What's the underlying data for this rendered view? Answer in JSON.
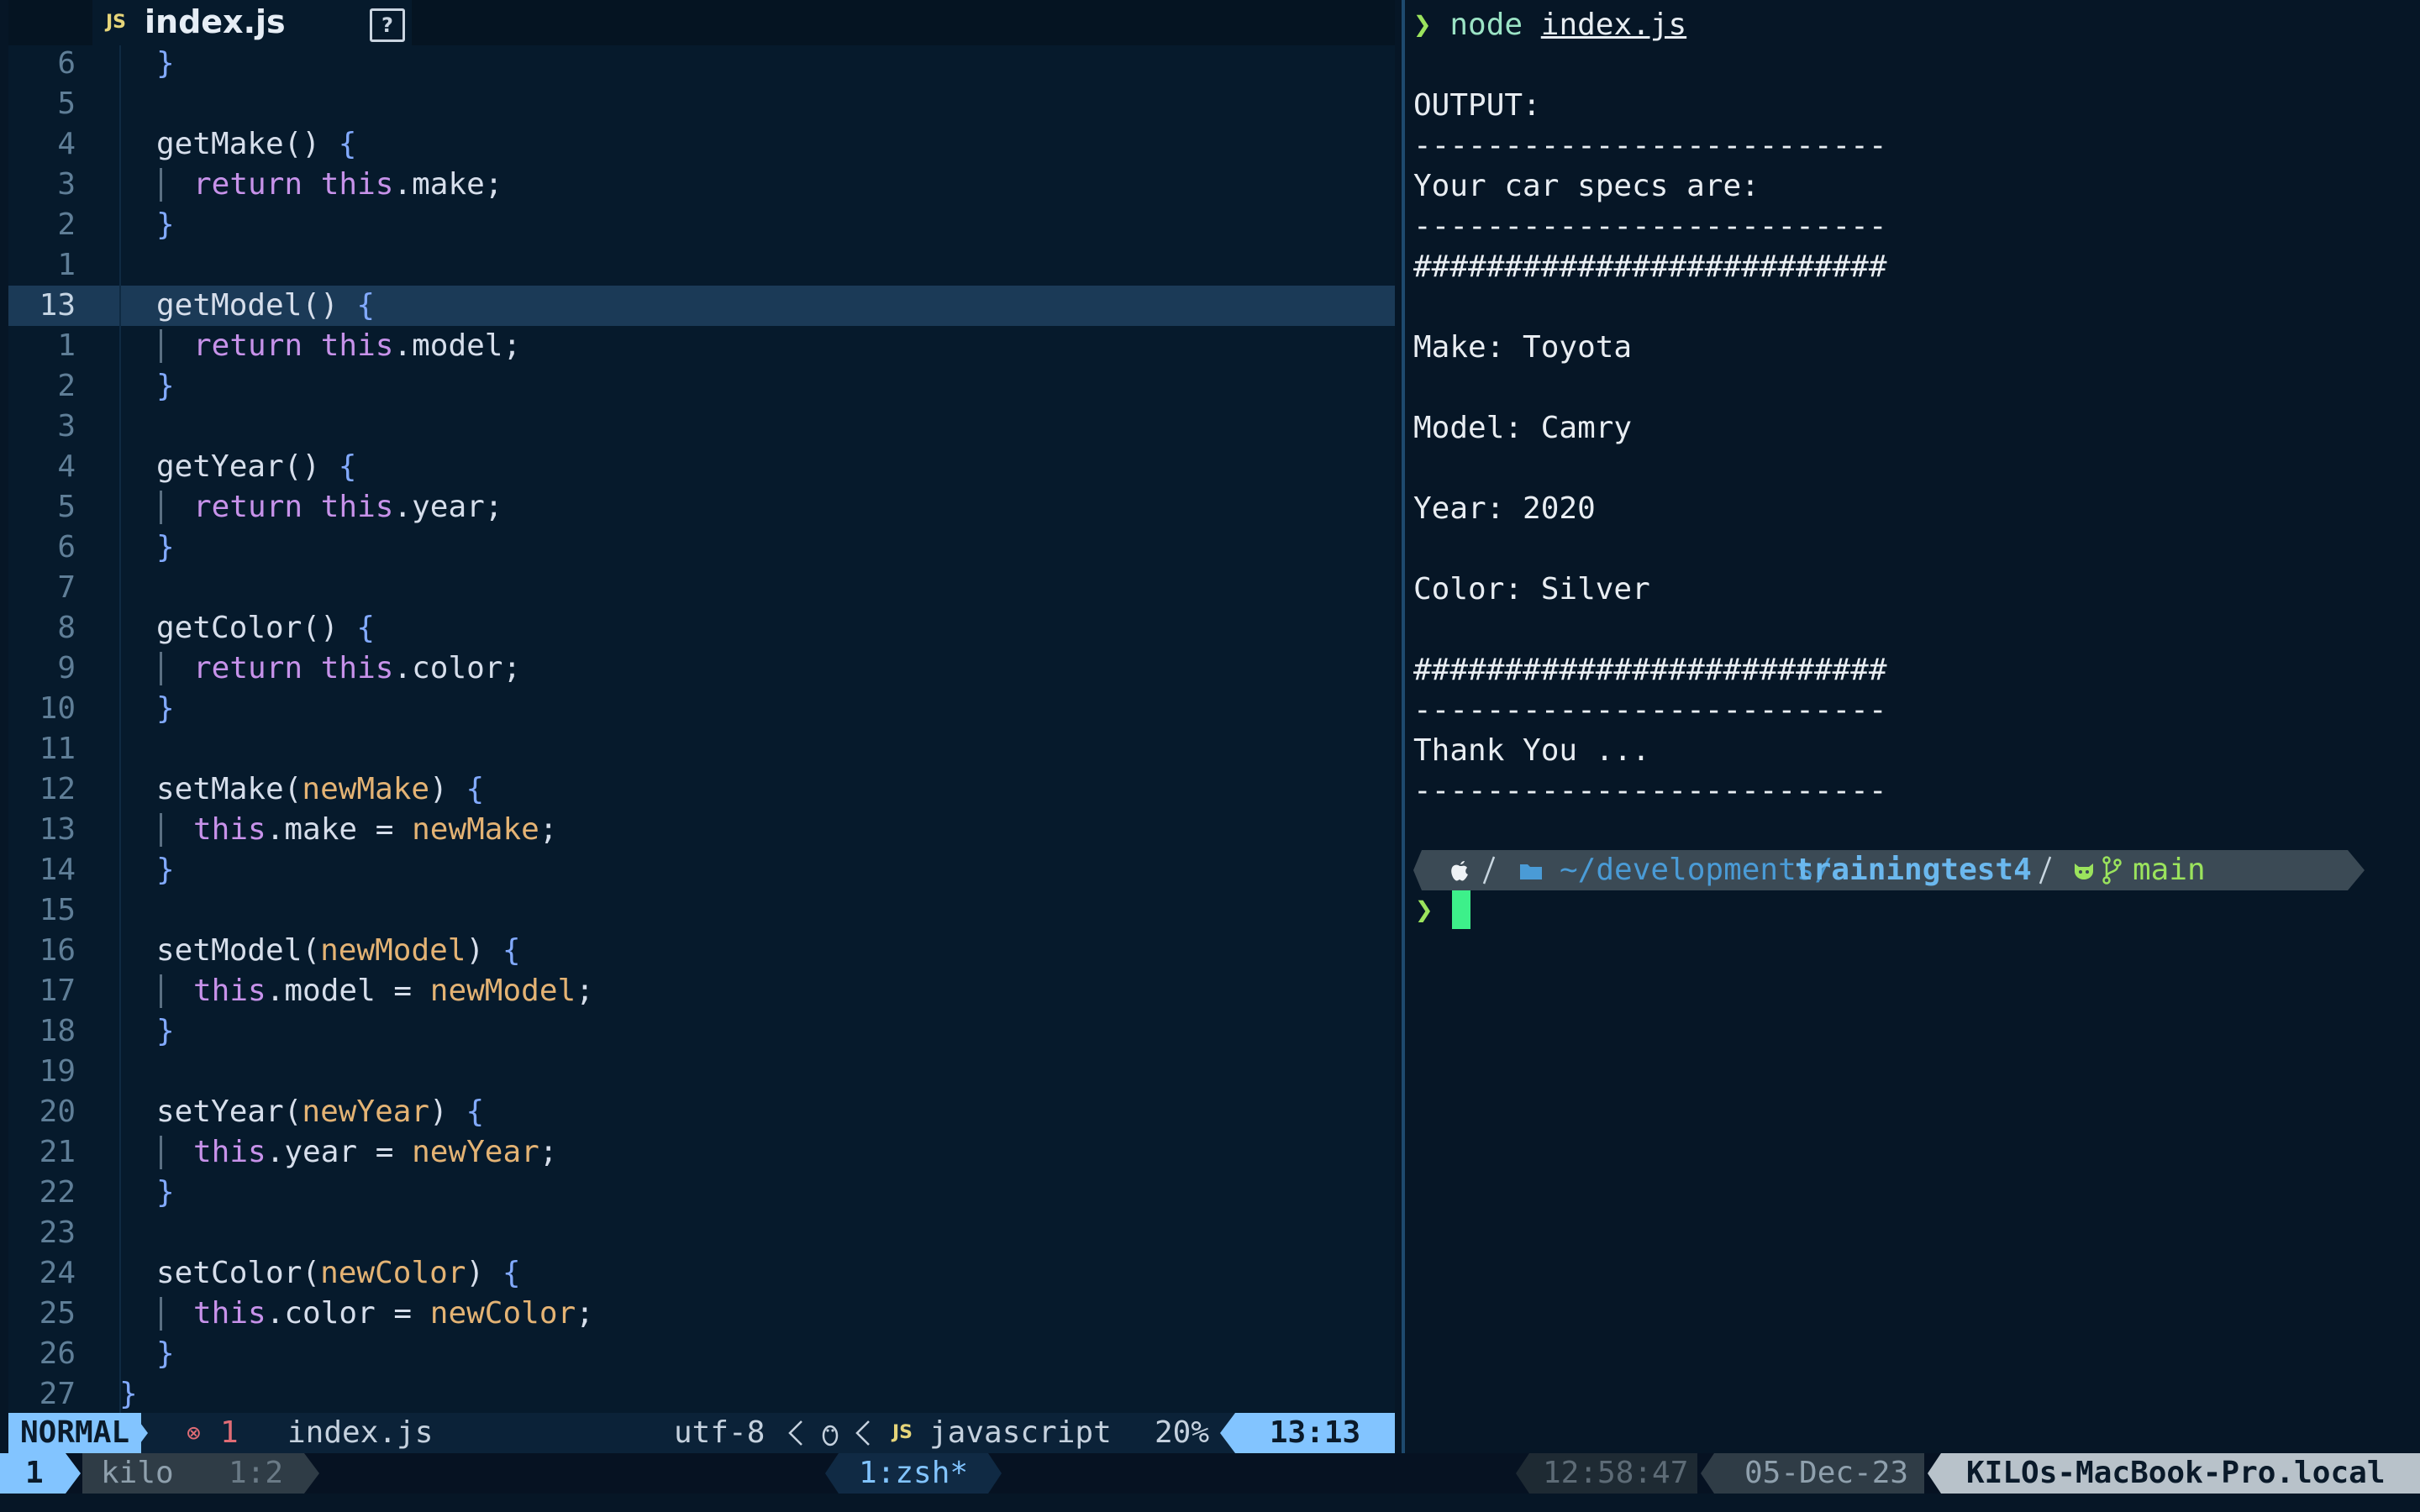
{
  "editor": {
    "tab": {
      "type_badge": "JS",
      "filename": "index.js",
      "help_glyph": "?"
    },
    "lines": [
      {
        "ln": "6",
        "indent": 1,
        "segs": [
          [
            "br",
            "}"
          ]
        ]
      },
      {
        "ln": "5",
        "indent": 0,
        "segs": []
      },
      {
        "ln": "4",
        "indent": 1,
        "segs": [
          [
            "fn",
            "getMake() "
          ],
          [
            "br",
            "{"
          ]
        ]
      },
      {
        "ln": "3",
        "indent": 2,
        "segs": [
          [
            "kw",
            "return "
          ],
          [
            "kw",
            "this"
          ],
          [
            "fn",
            ".make;"
          ]
        ]
      },
      {
        "ln": "2",
        "indent": 1,
        "segs": [
          [
            "br",
            "}"
          ]
        ]
      },
      {
        "ln": "1",
        "indent": 0,
        "segs": []
      },
      {
        "ln": "13",
        "indent": 1,
        "current": true,
        "segs": [
          [
            "fn",
            "getModel() "
          ],
          [
            "br",
            "{"
          ]
        ]
      },
      {
        "ln": "1",
        "indent": 2,
        "segs": [
          [
            "kw",
            "return "
          ],
          [
            "kw",
            "this"
          ],
          [
            "fn",
            ".model;"
          ]
        ]
      },
      {
        "ln": "2",
        "indent": 1,
        "segs": [
          [
            "br",
            "}"
          ]
        ]
      },
      {
        "ln": "3",
        "indent": 0,
        "segs": []
      },
      {
        "ln": "4",
        "indent": 1,
        "segs": [
          [
            "fn",
            "getYear() "
          ],
          [
            "br",
            "{"
          ]
        ]
      },
      {
        "ln": "5",
        "indent": 2,
        "segs": [
          [
            "kw",
            "return "
          ],
          [
            "kw",
            "this"
          ],
          [
            "fn",
            ".year;"
          ]
        ]
      },
      {
        "ln": "6",
        "indent": 1,
        "segs": [
          [
            "br",
            "}"
          ]
        ]
      },
      {
        "ln": "7",
        "indent": 0,
        "segs": []
      },
      {
        "ln": "8",
        "indent": 1,
        "segs": [
          [
            "fn",
            "getColor() "
          ],
          [
            "br",
            "{"
          ]
        ]
      },
      {
        "ln": "9",
        "indent": 2,
        "segs": [
          [
            "kw",
            "return "
          ],
          [
            "kw",
            "this"
          ],
          [
            "fn",
            ".color;"
          ]
        ]
      },
      {
        "ln": "10",
        "indent": 1,
        "segs": [
          [
            "br",
            "}"
          ]
        ]
      },
      {
        "ln": "11",
        "indent": 0,
        "segs": []
      },
      {
        "ln": "12",
        "indent": 1,
        "segs": [
          [
            "fn",
            "setMake("
          ],
          [
            "pm",
            "newMake"
          ],
          [
            "fn",
            ") "
          ],
          [
            "br",
            "{"
          ]
        ]
      },
      {
        "ln": "13",
        "indent": 2,
        "segs": [
          [
            "kw",
            "this"
          ],
          [
            "fn",
            ".make = "
          ],
          [
            "pm",
            "newMake"
          ],
          [
            "fn",
            ";"
          ]
        ]
      },
      {
        "ln": "14",
        "indent": 1,
        "segs": [
          [
            "br",
            "}"
          ]
        ]
      },
      {
        "ln": "15",
        "indent": 0,
        "segs": []
      },
      {
        "ln": "16",
        "indent": 1,
        "segs": [
          [
            "fn",
            "setModel("
          ],
          [
            "pm",
            "newModel"
          ],
          [
            "fn",
            ") "
          ],
          [
            "br",
            "{"
          ]
        ]
      },
      {
        "ln": "17",
        "indent": 2,
        "segs": [
          [
            "kw",
            "this"
          ],
          [
            "fn",
            ".model = "
          ],
          [
            "pm",
            "newModel"
          ],
          [
            "fn",
            ";"
          ]
        ]
      },
      {
        "ln": "18",
        "indent": 1,
        "segs": [
          [
            "br",
            "}"
          ]
        ]
      },
      {
        "ln": "19",
        "indent": 0,
        "segs": []
      },
      {
        "ln": "20",
        "indent": 1,
        "segs": [
          [
            "fn",
            "setYear("
          ],
          [
            "pm",
            "newYear"
          ],
          [
            "fn",
            ") "
          ],
          [
            "br",
            "{"
          ]
        ]
      },
      {
        "ln": "21",
        "indent": 2,
        "segs": [
          [
            "kw",
            "this"
          ],
          [
            "fn",
            ".year = "
          ],
          [
            "pm",
            "newYear"
          ],
          [
            "fn",
            ";"
          ]
        ]
      },
      {
        "ln": "22",
        "indent": 1,
        "segs": [
          [
            "br",
            "}"
          ]
        ]
      },
      {
        "ln": "23",
        "indent": 0,
        "segs": []
      },
      {
        "ln": "24",
        "indent": 1,
        "segs": [
          [
            "fn",
            "setColor("
          ],
          [
            "pm",
            "newColor"
          ],
          [
            "fn",
            ") "
          ],
          [
            "br",
            "{"
          ]
        ]
      },
      {
        "ln": "25",
        "indent": 2,
        "segs": [
          [
            "kw",
            "this"
          ],
          [
            "fn",
            ".color = "
          ],
          [
            "pm",
            "newColor"
          ],
          [
            "fn",
            ";"
          ]
        ]
      },
      {
        "ln": "26",
        "indent": 1,
        "segs": [
          [
            "br",
            "}"
          ]
        ]
      },
      {
        "ln": "27",
        "indent": 0,
        "segs": [
          [
            "br",
            "}"
          ]
        ]
      }
    ]
  },
  "statusline": {
    "mode": "NORMAL",
    "error_icon": "⊗",
    "error_count": "1",
    "filename": "index.js",
    "encoding": "utf-8",
    "os_icon": "linux-icon",
    "filetype_badge": "JS",
    "filetype": "javascript",
    "percent": "20%",
    "position": "13:13"
  },
  "terminal": {
    "prompt_symbol": "❯",
    "command": "node",
    "command_arg": "index.js",
    "output": [
      "OUTPUT:",
      "--------------------------",
      "Your car specs are:",
      "--------------------------",
      "##########################",
      "",
      "Make: Toyota",
      "",
      "Model: Camry",
      "",
      "Year: 2020",
      "",
      "Color: Silver",
      "",
      "##########################",
      "--------------------------",
      "Thank You ...",
      "--------------------------"
    ],
    "powerline": {
      "os_icon": "apple-icon",
      "path_prefix": "~/developments/",
      "path_current": "trainingtest4",
      "git_icon": "github-icon",
      "branch_icon": "git-branch-icon",
      "branch": "main"
    }
  },
  "tmux": {
    "session": "1",
    "window_name": "kilo",
    "pane": "1:2",
    "active_window": "1:zsh*",
    "time": "12:58:47",
    "date": "05-Dec-23",
    "host": "KILOs-MacBook-Pro.local"
  },
  "colors": {
    "background": "#061626",
    "keyword": "#c792ea",
    "brace": "#82aaff",
    "param": "#e4b374",
    "mode_accent": "#82c4ff",
    "prompt_green": "#9be35d",
    "cursor": "#3df08a"
  }
}
